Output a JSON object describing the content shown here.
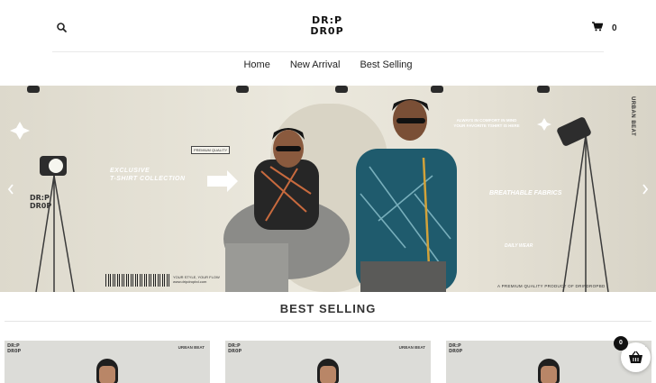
{
  "header": {
    "logo_line1": "DR:P",
    "logo_line2": "DR0P",
    "cart_count": "0",
    "icons": {
      "search": "search-icon",
      "cart": "cart-icon"
    }
  },
  "nav": {
    "items": [
      "Home",
      "New Arrival",
      "Best Selling"
    ]
  },
  "hero": {
    "logo_line1": "DR:P",
    "logo_line2": "DR0P",
    "badge": "PREMIUM QUALITY",
    "left_heading_1": "EXCLUSIVE",
    "left_heading_2": "T-SHIRT COLLECTION",
    "barcode_text_1": "YOUR STYLE, YOUR FLOW",
    "barcode_text_2": "www.dripdropbd.com",
    "right_top_1": "ALWAYS IN COMFORT IN MIND",
    "right_top_2": "YOUR FAVORITE TSHIRT IS HERE",
    "right_heading": "BREATHABLE FABRICS",
    "daily": "DAILY WEAR",
    "tagline": "A PREMIUM QUALITY PRODUCT OF DRIPDROPBD",
    "vertical": "URBAN BEAT",
    "icons": {
      "prev": "chevron-left-icon",
      "next": "chevron-right-icon"
    }
  },
  "best_selling": {
    "title": "BEST SELLING",
    "cards": [
      {
        "logo_1": "DR:P",
        "logo_2": "DR0P",
        "brand": "URBAN BEAT"
      },
      {
        "logo_1": "DR:P",
        "logo_2": "DR0P",
        "brand": "URBAN BEAT"
      },
      {
        "logo_1": "DR:P",
        "logo_2": "DR0P",
        "brand": "URBAN BEAT"
      }
    ]
  },
  "floating_cart": {
    "count": "0",
    "icon": "basket-icon"
  }
}
